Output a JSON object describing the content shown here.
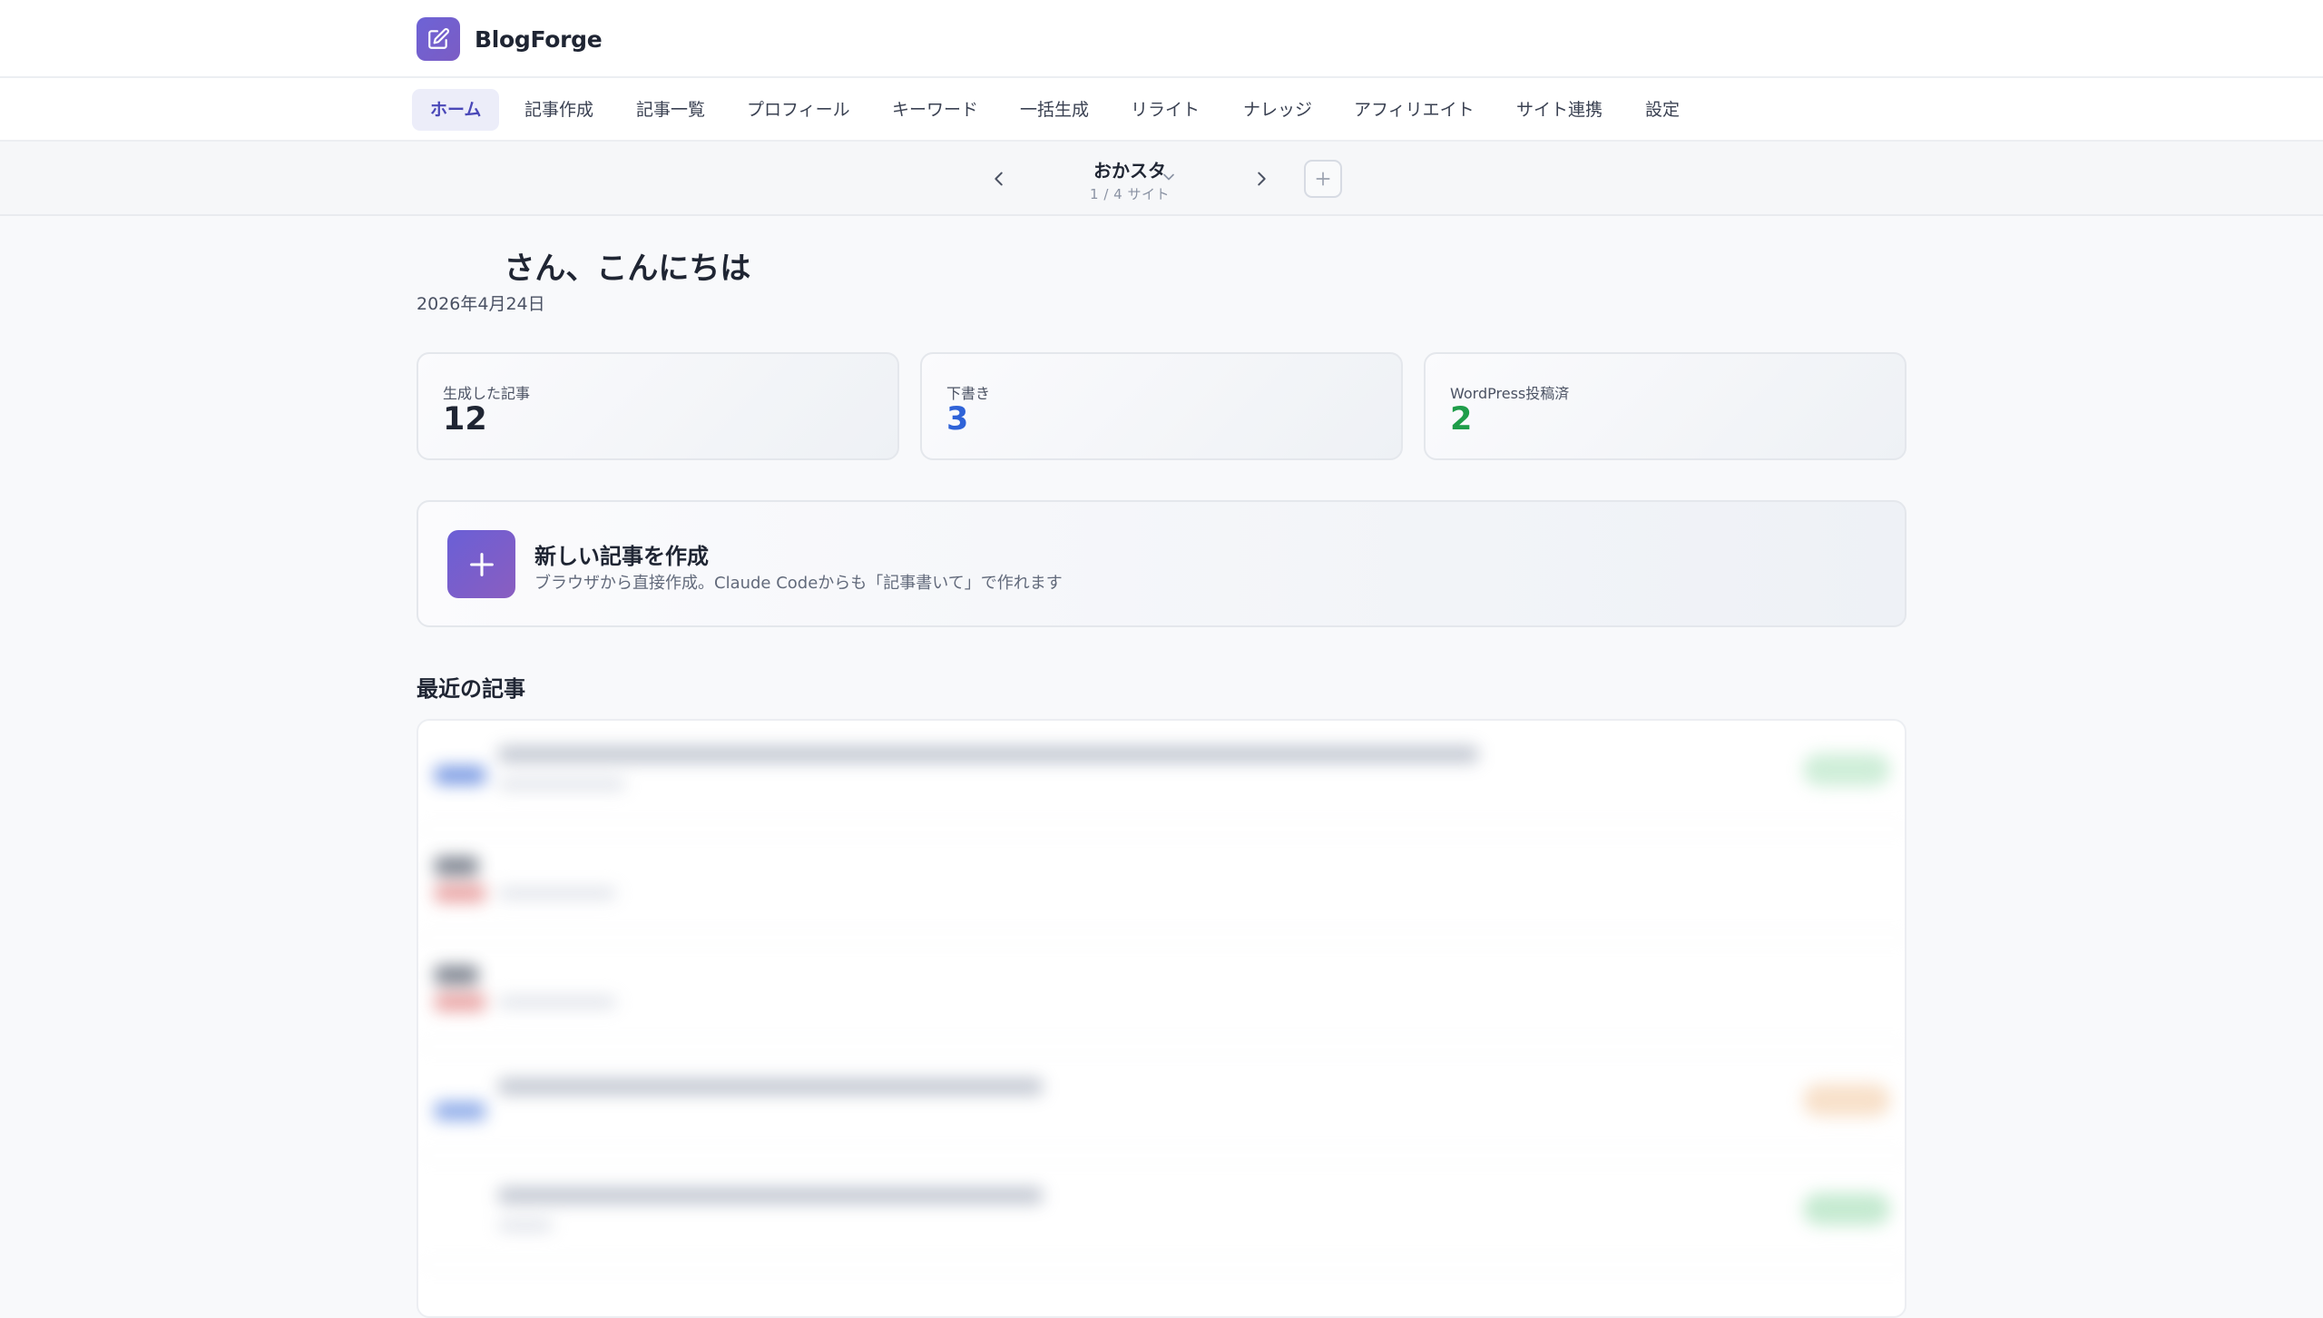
{
  "app": {
    "name": "BlogForge",
    "logo_icon": "edit-icon",
    "accent_color": "#6d63d6"
  },
  "nav": {
    "items": [
      {
        "label": "ホーム",
        "active": true
      },
      {
        "label": "記事作成",
        "active": false
      },
      {
        "label": "記事一覧",
        "active": false
      },
      {
        "label": "プロフィール",
        "active": false
      },
      {
        "label": "キーワード",
        "active": false
      },
      {
        "label": "一括生成",
        "active": false
      },
      {
        "label": "リライト",
        "active": false
      },
      {
        "label": "ナレッジ",
        "active": false
      },
      {
        "label": "アフィリエイト",
        "active": false
      },
      {
        "label": "サイト連携",
        "active": false
      },
      {
        "label": "設定",
        "active": false
      }
    ]
  },
  "site_switcher": {
    "site_name": "おかスタ",
    "counter": "1 / 4 サイト",
    "prev_icon": "chevron-left-icon",
    "next_icon": "chevron-right-icon",
    "dropdown_icon": "chevron-down-icon",
    "add_icon": "plus-icon"
  },
  "greeting": {
    "name_redacted": "■■■",
    "text": "さん、こんにちは",
    "date": "2026年4月24日"
  },
  "stats": [
    {
      "label": "生成した記事",
      "value": "12",
      "color": "#1f2533"
    },
    {
      "label": "下書き",
      "value": "3",
      "color": "#2f63d8"
    },
    {
      "label": "WordPress投稿済",
      "value": "2",
      "color": "#1f9d4a"
    }
  ],
  "create_card": {
    "title": "新しい記事を作成",
    "description": "ブラウザから直接作成。Claude Codeからも「記事書いて」で作れます",
    "icon": "plus-icon"
  },
  "recent": {
    "title": "最近の記事",
    "rows_note_blurred": true
  }
}
